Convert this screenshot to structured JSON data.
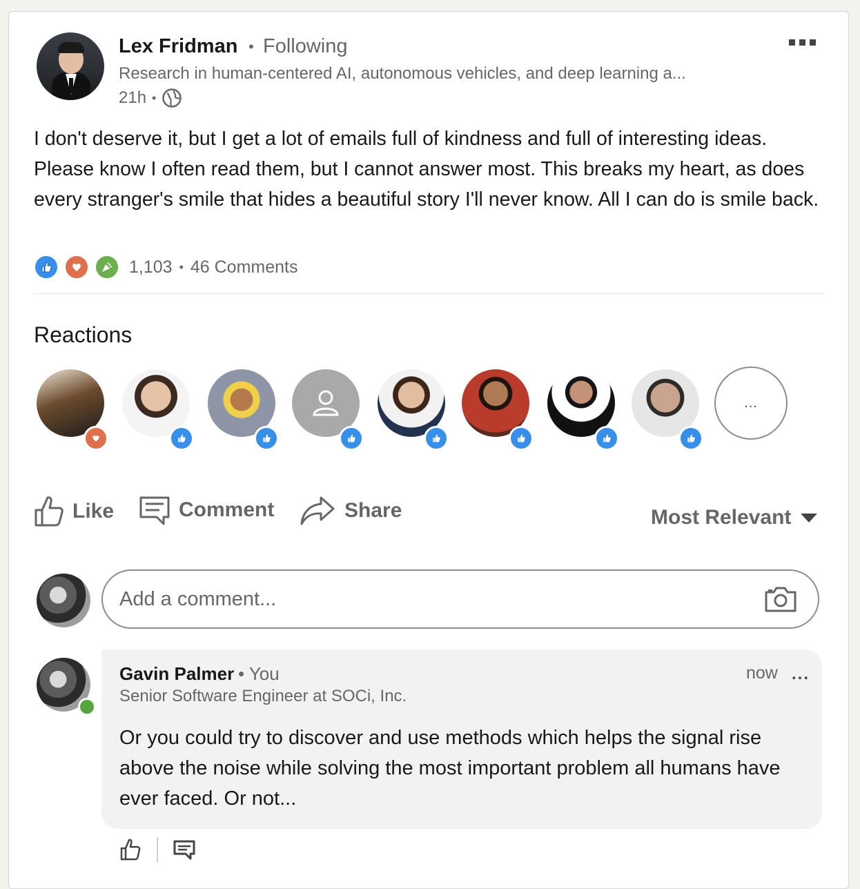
{
  "post": {
    "author_name": "Lex Fridman",
    "follow_status": "Following",
    "headline": "Research in human-centered AI, autonomous vehicles, and deep learning a...",
    "timestamp": "21h",
    "visibility_icon": "globe-icon",
    "text": "I don't deserve it, but I get a lot of emails full of kindness and full of interesting ideas. Please know I often read them, but I cannot answer most. This breaks my heart, as does every stranger's smile that hides a beautiful story I'll never know. All I can do is smile back.",
    "reaction_count": "1,103",
    "comments_count": "46 Comments"
  },
  "reactions_section": {
    "title": "Reactions",
    "more_label": "...",
    "people": [
      {
        "reaction": "love"
      },
      {
        "reaction": "like"
      },
      {
        "reaction": "like"
      },
      {
        "reaction": "like"
      },
      {
        "reaction": "like"
      },
      {
        "reaction": "like"
      },
      {
        "reaction": "like"
      },
      {
        "reaction": "like"
      }
    ]
  },
  "actions": {
    "like_label": "Like",
    "comment_label": "Comment",
    "share_label": "Share",
    "sort_label": "Most Relevant"
  },
  "comment_input": {
    "placeholder": "Add a comment..."
  },
  "comment": {
    "author_name": "Gavin Palmer",
    "relation": "• You",
    "headline": "Senior Software Engineer at SOCi, Inc.",
    "time": "now",
    "text": "Or you could try to discover and use methods which helps the signal rise above the noise while solving the most important problem all humans have ever faced.  Or not...",
    "more_label": "..."
  },
  "colors": {
    "like": "#378fe9",
    "love": "#df704d",
    "celebrate": "#6dae4f",
    "online": "#57a53f"
  }
}
